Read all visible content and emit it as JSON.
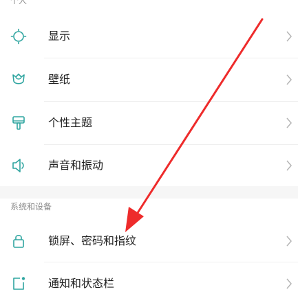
{
  "sections": [
    {
      "header": "个人",
      "items": [
        {
          "label": "显示",
          "icon": "sun-icon"
        },
        {
          "label": "壁纸",
          "icon": "tulip-icon"
        },
        {
          "label": "个性主题",
          "icon": "paint-brush-icon"
        },
        {
          "label": "声音和振动",
          "icon": "speaker-icon"
        }
      ]
    },
    {
      "header": "系统和设备",
      "items": [
        {
          "label": "锁屏、密码和指纹",
          "icon": "lock-icon"
        },
        {
          "label": "通知和状态栏",
          "icon": "notification-icon"
        }
      ]
    }
  ],
  "colors": {
    "icon_accent": "#2fa5a0",
    "annotation_arrow": "#ee2b2b"
  }
}
